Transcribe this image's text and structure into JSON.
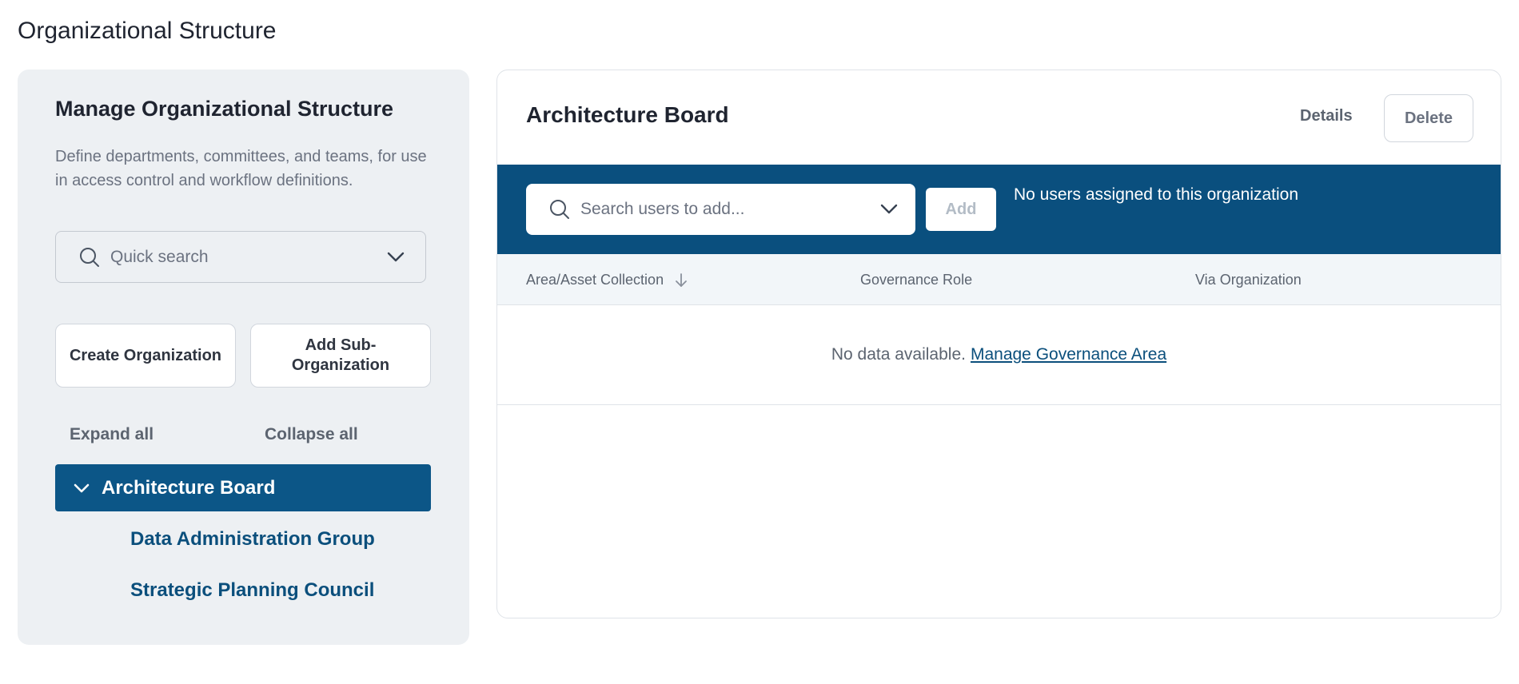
{
  "page": {
    "title": "Organizational Structure"
  },
  "left_panel": {
    "title": "Manage Organizational Structure",
    "description": "Define departments, committees, and teams, for use in access control and workflow definitions.",
    "quick_search": {
      "placeholder": "Quick search",
      "icon": "search-icon",
      "dropdown_icon": "chevron-down-icon"
    },
    "buttons": {
      "create_org": "Create Organization",
      "add_sub_org": "Add Sub-Organization"
    },
    "expand_all": "Expand all",
    "collapse_all": "Collapse all",
    "tree": {
      "selected": {
        "label": "Architecture Board",
        "icon": "chevron-down-icon",
        "expanded": true
      },
      "children": [
        {
          "label": "Data Administration Group"
        },
        {
          "label": "Strategic Planning Council"
        }
      ]
    }
  },
  "right_panel": {
    "title": "Architecture Board",
    "details_label": "Details",
    "delete_label": "Delete",
    "user_search": {
      "placeholder": "Search users to add...",
      "icon": "search-icon",
      "dropdown_icon": "chevron-down-icon"
    },
    "add_label": "Add",
    "no_users_text": "No users assigned to this organization",
    "table": {
      "columns": [
        "Area/Asset Collection",
        "Governance Role",
        "Via Organization"
      ],
      "sort_icon": "arrow-down-icon",
      "empty_text": "No data available.",
      "empty_link": "Manage Governance Area"
    }
  },
  "colors": {
    "accent_blue": "#0a4f7e",
    "selected_tree_bg": "#0c5687",
    "link_blue": "#0b4f7c",
    "panel_bg": "#edf0f3",
    "table_header_bg": "#f2f6f9"
  }
}
